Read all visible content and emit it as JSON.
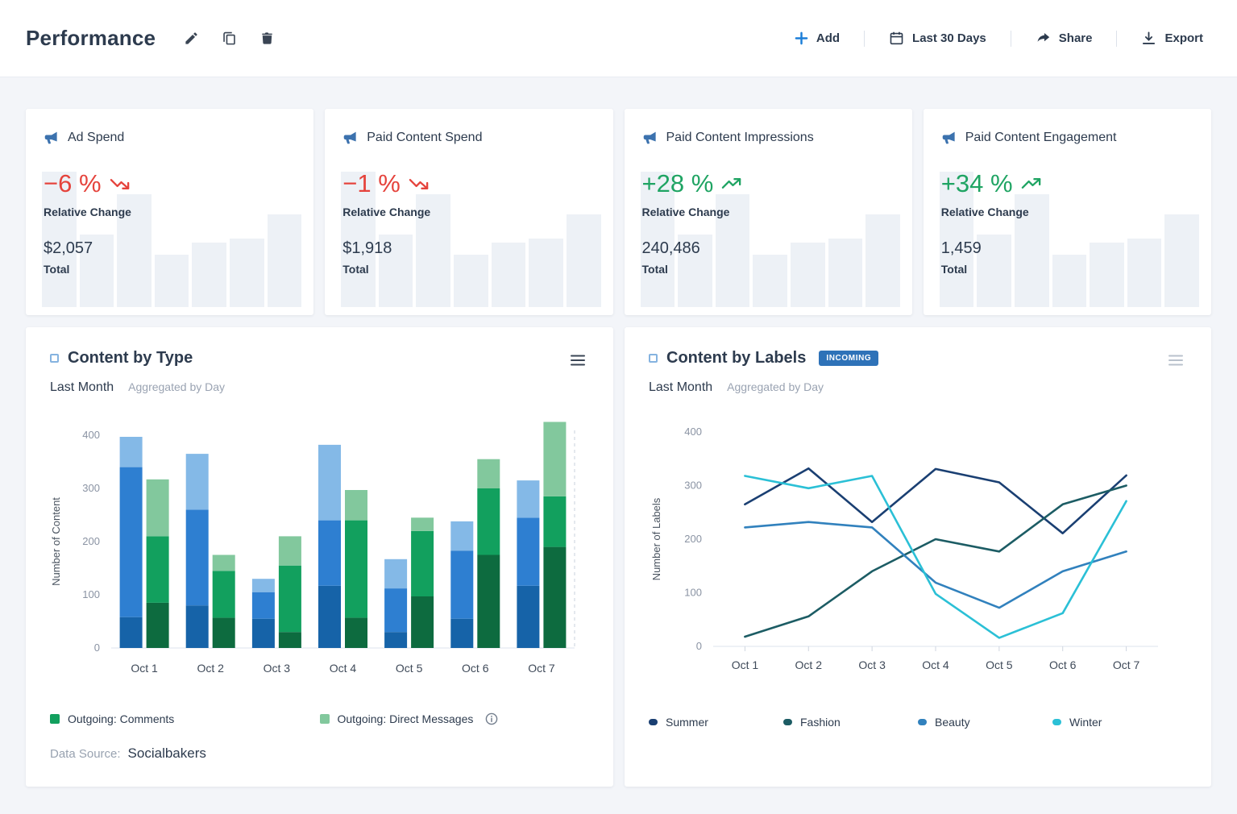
{
  "header": {
    "title": "Performance",
    "add_label": "Add",
    "date_range_label": "Last 30 Days",
    "share_label": "Share",
    "export_label": "Export"
  },
  "kpis": {
    "change_label": "Relative Change",
    "total_label": "Total",
    "spark_heights": [
      168,
      90,
      140,
      65,
      80,
      85,
      115
    ],
    "cards": [
      {
        "title": "Ad Spend",
        "change": "−6 %",
        "trend": "down",
        "total": "$2,057",
        "color": "#e5433c"
      },
      {
        "title": "Paid Content Spend",
        "change": "−1 %",
        "trend": "down",
        "total": "$1,918",
        "color": "#e5433c"
      },
      {
        "title": "Paid Content Impressions",
        "change": "+28 %",
        "trend": "up",
        "total": "240,486",
        "color": "#1fa463"
      },
      {
        "title": "Paid Content Engagement",
        "change": "+34 %",
        "trend": "up",
        "total": "1,459",
        "color": "#1fa463"
      }
    ]
  },
  "chart_data": [
    {
      "type": "bar",
      "stacked": true,
      "title": "Content by Type",
      "subtitle": "Last Month",
      "aggregation": "Aggregated by Day",
      "ylabel": "Number of Content",
      "ylim": [
        0,
        400
      ],
      "yticks": [
        0,
        100,
        200,
        300,
        400
      ],
      "grid": false,
      "categories": [
        "Oct 1",
        "Oct 2",
        "Oct 3",
        "Oct 4",
        "Oct 5",
        "Oct 6",
        "Oct 7"
      ],
      "stacks": [
        {
          "name": "Incoming",
          "segments": [
            {
              "name": "incoming-dark-blue",
              "color": "#1663a8",
              "values": [
                58,
                80,
                55,
                117,
                30,
                55,
                117
              ]
            },
            {
              "name": "incoming-blue",
              "color": "#2e7fd1",
              "values": [
                282,
                180,
                50,
                123,
                82,
                128,
                128
              ]
            },
            {
              "name": "incoming-light-blue",
              "color": "#84b9e7",
              "values": [
                57,
                105,
                25,
                142,
                55,
                55,
                70
              ]
            }
          ]
        },
        {
          "name": "Outgoing",
          "segments": [
            {
              "name": "outgoing-dark-green",
              "color": "#0d6b3f",
              "values": [
                85,
                57,
                30,
                57,
                97,
                175,
                190
              ]
            },
            {
              "name": "outgoing-green",
              "color": "#12a05e",
              "values": [
                125,
                88,
                125,
                183,
                123,
                125,
                95
              ]
            },
            {
              "name": "outgoing-light-green",
              "color": "#82c89d",
              "values": [
                107,
                30,
                55,
                57,
                25,
                55,
                140
              ]
            }
          ]
        }
      ],
      "legend": [
        {
          "label": "Outgoing: Comments",
          "color": "#12a05e"
        },
        {
          "label": "Outgoing: Direct Messages",
          "color": "#82c89d"
        }
      ],
      "data_source_label": "Data Source:",
      "data_source": "Socialbakers"
    },
    {
      "type": "line",
      "title": "Content by Labels",
      "badge": "INCOMING",
      "badge_color": "#2e72b8",
      "subtitle": "Last Month",
      "aggregation": "Aggregated by Day",
      "ylabel": "Number of Labels",
      "ylim": [
        0,
        400
      ],
      "yticks": [
        0,
        100,
        200,
        300,
        400
      ],
      "grid": false,
      "legend_position": "bottom",
      "categories": [
        "Oct 1",
        "Oct 2",
        "Oct 3",
        "Oct 4",
        "Oct 5",
        "Oct 6",
        "Oct 7"
      ],
      "series": [
        {
          "name": "Summer",
          "color": "#1a3f72",
          "values": [
            265,
            332,
            232,
            331,
            306,
            211,
            319
          ]
        },
        {
          "name": "Fashion",
          "color": "#1c5c64",
          "values": [
            18,
            56,
            140,
            200,
            177,
            265,
            300
          ]
        },
        {
          "name": "Beauty",
          "color": "#3181bd",
          "values": [
            222,
            232,
            222,
            119,
            72,
            140,
            177
          ]
        },
        {
          "name": "Winter",
          "color": "#2bc0d6",
          "values": [
            318,
            295,
            318,
            98,
            16,
            62,
            271
          ]
        }
      ]
    }
  ]
}
